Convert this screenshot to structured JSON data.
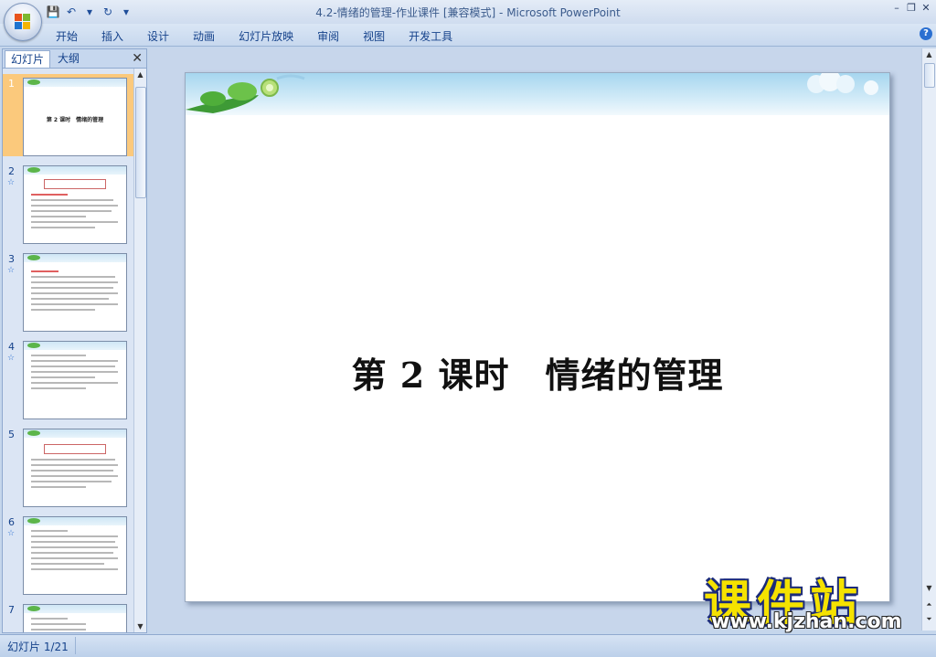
{
  "window": {
    "title_doc": "4.2-情绪的管理-作业课件 [兼容模式]",
    "title_sep": " - ",
    "title_app": "Microsoft PowerPoint"
  },
  "qat": {
    "save_icon": "💾",
    "undo_icon": "↶",
    "redo_icon": "↻",
    "dropdown_icon": "▾"
  },
  "ribbon": {
    "tabs": [
      "开始",
      "插入",
      "设计",
      "动画",
      "幻灯片放映",
      "审阅",
      "视图",
      "开发工具"
    ],
    "help": "?"
  },
  "window_controls": {
    "minimize": "–",
    "restore": "❐",
    "close": "✕"
  },
  "left_pane": {
    "tab_slides": "幻灯片",
    "tab_outline": "大纲",
    "close": "✕",
    "thumbnails": [
      {
        "num": "1",
        "title": "第 2 课时　情绪的管理",
        "star": ""
      },
      {
        "num": "2",
        "title": "",
        "star": "☆"
      },
      {
        "num": "3",
        "title": "",
        "star": "☆"
      },
      {
        "num": "4",
        "title": "",
        "star": "☆"
      },
      {
        "num": "5",
        "title": "",
        "star": ""
      },
      {
        "num": "6",
        "title": "",
        "star": "☆"
      },
      {
        "num": "7",
        "title": "",
        "star": ""
      }
    ]
  },
  "slide": {
    "title": "第 2 课时　情绪的管理"
  },
  "status": {
    "slide_indicator": "幻灯片 1/21"
  },
  "watermark": {
    "logo": "课件站",
    "url": "www.kjzhan.com"
  }
}
